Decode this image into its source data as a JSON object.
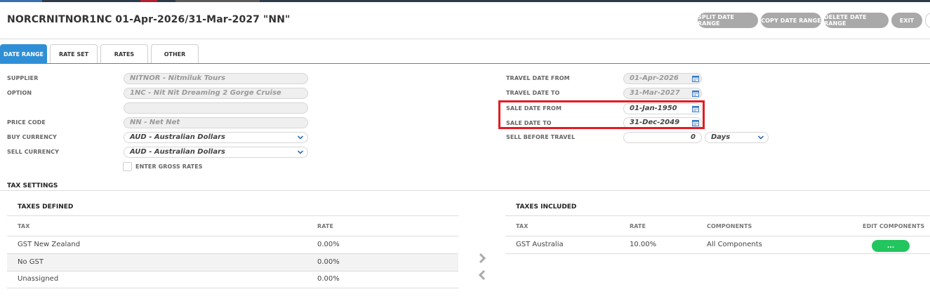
{
  "page": {
    "title": "NORCRNITNOR1NC 01-Apr-2026/31-Mar-2027 \"NN\""
  },
  "header_buttons": {
    "split": "SPLIT DATE RANGE",
    "copy": "COPY DATE RANGE",
    "delete": "DELETE DATE RANGE",
    "exit": "EXIT"
  },
  "tabs": [
    {
      "label": "DATE RANGE",
      "active": true
    },
    {
      "label": "RATE SET",
      "active": false
    },
    {
      "label": "RATES",
      "active": false
    },
    {
      "label": "OTHER",
      "active": false
    }
  ],
  "form": {
    "supplier": {
      "label": "SUPPLIER",
      "value": "NITNOR - Nitmiluk Tours"
    },
    "option": {
      "label": "OPTION",
      "value": "1NC - Nit Nit Dreaming 2 Gorge Cruise",
      "value2": ""
    },
    "price_code": {
      "label": "PRICE CODE",
      "value": "NN - Net Net"
    },
    "buy_currency": {
      "label": "BUY CURRENCY",
      "value": "AUD - Australian Dollars"
    },
    "sell_currency": {
      "label": "SELL CURRENCY",
      "value": "AUD - Australian Dollars"
    },
    "gross_rates": {
      "label": "ENTER GROSS RATES",
      "checked": false
    },
    "travel_from": {
      "label": "TRAVEL DATE FROM",
      "value": "01-Apr-2026"
    },
    "travel_to": {
      "label": "TRAVEL DATE TO",
      "value": "31-Mar-2027"
    },
    "sale_from": {
      "label": "SALE DATE FROM",
      "value": "01-Jan-1950"
    },
    "sale_to": {
      "label": "SALE DATE TO",
      "value": "31-Dec-2049"
    },
    "sell_before": {
      "label": "SELL BEFORE TRAVEL",
      "value": "0",
      "unit": "Days"
    }
  },
  "tax": {
    "section_title": "TAX SETTINGS",
    "defined": {
      "title": "TAXES DEFINED",
      "headers": {
        "tax": "TAX",
        "rate": "RATE"
      },
      "rows": [
        {
          "tax": "GST New Zealand",
          "rate": "0.00%"
        },
        {
          "tax": "No GST",
          "rate": "0.00%"
        },
        {
          "tax": "Unassigned",
          "rate": "0.00%"
        }
      ]
    },
    "included": {
      "title": "TAXES INCLUDED",
      "headers": {
        "tax": "TAX",
        "rate": "RATE",
        "components": "COMPONENTS",
        "edit": "EDIT COMPONENTS"
      },
      "rows": [
        {
          "tax": "GST Australia",
          "rate": "10.00%",
          "components": "All Components",
          "edit": "..."
        }
      ]
    }
  },
  "icons": {
    "calendar": "calendar-icon",
    "dropdown": "chevron-down-icon",
    "move_right": "chevron-right-icon",
    "move_left": "chevron-left-icon"
  },
  "colors": {
    "accent": "#2f8fd6",
    "button_grey": "#a9a9a9",
    "highlight": "#e31b23",
    "pill_green": "#22c55e"
  }
}
